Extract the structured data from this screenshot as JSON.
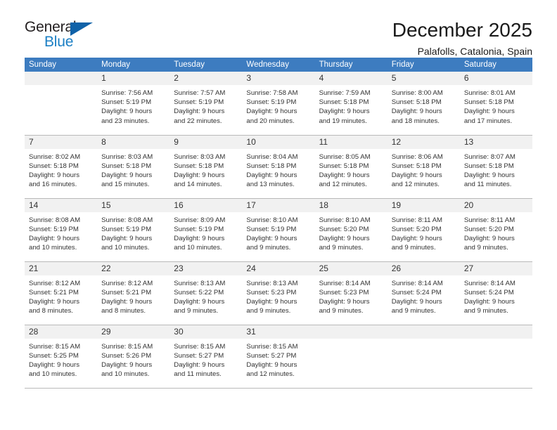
{
  "brand": {
    "name_top": "General",
    "name_bottom": "Blue",
    "triangle_color": "#1062a8",
    "blue_color": "#1b7fc4"
  },
  "header": {
    "title": "December 2025",
    "subtitle": "Palafolls, Catalonia, Spain"
  },
  "theme": {
    "header_bg": "#3d7cc0",
    "header_text": "#ffffff",
    "daynum_bg": "#f1f1f1",
    "border": "#b9b9b9",
    "body_text": "#333333"
  },
  "weekdays": [
    "Sunday",
    "Monday",
    "Tuesday",
    "Wednesday",
    "Thursday",
    "Friday",
    "Saturday"
  ],
  "labels": {
    "sunrise_prefix": "Sunrise:",
    "sunset_prefix": "Sunset:",
    "daylight_prefix": "Daylight:"
  },
  "weeks": [
    [
      {
        "day": "",
        "line1": "",
        "line2": "",
        "line3": "",
        "line4": ""
      },
      {
        "day": "1",
        "line1": "Sunrise: 7:56 AM",
        "line2": "Sunset: 5:19 PM",
        "line3": "Daylight: 9 hours",
        "line4": "and 23 minutes."
      },
      {
        "day": "2",
        "line1": "Sunrise: 7:57 AM",
        "line2": "Sunset: 5:19 PM",
        "line3": "Daylight: 9 hours",
        "line4": "and 22 minutes."
      },
      {
        "day": "3",
        "line1": "Sunrise: 7:58 AM",
        "line2": "Sunset: 5:19 PM",
        "line3": "Daylight: 9 hours",
        "line4": "and 20 minutes."
      },
      {
        "day": "4",
        "line1": "Sunrise: 7:59 AM",
        "line2": "Sunset: 5:18 PM",
        "line3": "Daylight: 9 hours",
        "line4": "and 19 minutes."
      },
      {
        "day": "5",
        "line1": "Sunrise: 8:00 AM",
        "line2": "Sunset: 5:18 PM",
        "line3": "Daylight: 9 hours",
        "line4": "and 18 minutes."
      },
      {
        "day": "6",
        "line1": "Sunrise: 8:01 AM",
        "line2": "Sunset: 5:18 PM",
        "line3": "Daylight: 9 hours",
        "line4": "and 17 minutes."
      }
    ],
    [
      {
        "day": "7",
        "line1": "Sunrise: 8:02 AM",
        "line2": "Sunset: 5:18 PM",
        "line3": "Daylight: 9 hours",
        "line4": "and 16 minutes."
      },
      {
        "day": "8",
        "line1": "Sunrise: 8:03 AM",
        "line2": "Sunset: 5:18 PM",
        "line3": "Daylight: 9 hours",
        "line4": "and 15 minutes."
      },
      {
        "day": "9",
        "line1": "Sunrise: 8:03 AM",
        "line2": "Sunset: 5:18 PM",
        "line3": "Daylight: 9 hours",
        "line4": "and 14 minutes."
      },
      {
        "day": "10",
        "line1": "Sunrise: 8:04 AM",
        "line2": "Sunset: 5:18 PM",
        "line3": "Daylight: 9 hours",
        "line4": "and 13 minutes."
      },
      {
        "day": "11",
        "line1": "Sunrise: 8:05 AM",
        "line2": "Sunset: 5:18 PM",
        "line3": "Daylight: 9 hours",
        "line4": "and 12 minutes."
      },
      {
        "day": "12",
        "line1": "Sunrise: 8:06 AM",
        "line2": "Sunset: 5:18 PM",
        "line3": "Daylight: 9 hours",
        "line4": "and 12 minutes."
      },
      {
        "day": "13",
        "line1": "Sunrise: 8:07 AM",
        "line2": "Sunset: 5:18 PM",
        "line3": "Daylight: 9 hours",
        "line4": "and 11 minutes."
      }
    ],
    [
      {
        "day": "14",
        "line1": "Sunrise: 8:08 AM",
        "line2": "Sunset: 5:19 PM",
        "line3": "Daylight: 9 hours",
        "line4": "and 10 minutes."
      },
      {
        "day": "15",
        "line1": "Sunrise: 8:08 AM",
        "line2": "Sunset: 5:19 PM",
        "line3": "Daylight: 9 hours",
        "line4": "and 10 minutes."
      },
      {
        "day": "16",
        "line1": "Sunrise: 8:09 AM",
        "line2": "Sunset: 5:19 PM",
        "line3": "Daylight: 9 hours",
        "line4": "and 10 minutes."
      },
      {
        "day": "17",
        "line1": "Sunrise: 8:10 AM",
        "line2": "Sunset: 5:19 PM",
        "line3": "Daylight: 9 hours",
        "line4": "and 9 minutes."
      },
      {
        "day": "18",
        "line1": "Sunrise: 8:10 AM",
        "line2": "Sunset: 5:20 PM",
        "line3": "Daylight: 9 hours",
        "line4": "and 9 minutes."
      },
      {
        "day": "19",
        "line1": "Sunrise: 8:11 AM",
        "line2": "Sunset: 5:20 PM",
        "line3": "Daylight: 9 hours",
        "line4": "and 9 minutes."
      },
      {
        "day": "20",
        "line1": "Sunrise: 8:11 AM",
        "line2": "Sunset: 5:20 PM",
        "line3": "Daylight: 9 hours",
        "line4": "and 9 minutes."
      }
    ],
    [
      {
        "day": "21",
        "line1": "Sunrise: 8:12 AM",
        "line2": "Sunset: 5:21 PM",
        "line3": "Daylight: 9 hours",
        "line4": "and 8 minutes."
      },
      {
        "day": "22",
        "line1": "Sunrise: 8:12 AM",
        "line2": "Sunset: 5:21 PM",
        "line3": "Daylight: 9 hours",
        "line4": "and 8 minutes."
      },
      {
        "day": "23",
        "line1": "Sunrise: 8:13 AM",
        "line2": "Sunset: 5:22 PM",
        "line3": "Daylight: 9 hours",
        "line4": "and 9 minutes."
      },
      {
        "day": "24",
        "line1": "Sunrise: 8:13 AM",
        "line2": "Sunset: 5:23 PM",
        "line3": "Daylight: 9 hours",
        "line4": "and 9 minutes."
      },
      {
        "day": "25",
        "line1": "Sunrise: 8:14 AM",
        "line2": "Sunset: 5:23 PM",
        "line3": "Daylight: 9 hours",
        "line4": "and 9 minutes."
      },
      {
        "day": "26",
        "line1": "Sunrise: 8:14 AM",
        "line2": "Sunset: 5:24 PM",
        "line3": "Daylight: 9 hours",
        "line4": "and 9 minutes."
      },
      {
        "day": "27",
        "line1": "Sunrise: 8:14 AM",
        "line2": "Sunset: 5:24 PM",
        "line3": "Daylight: 9 hours",
        "line4": "and 9 minutes."
      }
    ],
    [
      {
        "day": "28",
        "line1": "Sunrise: 8:15 AM",
        "line2": "Sunset: 5:25 PM",
        "line3": "Daylight: 9 hours",
        "line4": "and 10 minutes."
      },
      {
        "day": "29",
        "line1": "Sunrise: 8:15 AM",
        "line2": "Sunset: 5:26 PM",
        "line3": "Daylight: 9 hours",
        "line4": "and 10 minutes."
      },
      {
        "day": "30",
        "line1": "Sunrise: 8:15 AM",
        "line2": "Sunset: 5:27 PM",
        "line3": "Daylight: 9 hours",
        "line4": "and 11 minutes."
      },
      {
        "day": "31",
        "line1": "Sunrise: 8:15 AM",
        "line2": "Sunset: 5:27 PM",
        "line3": "Daylight: 9 hours",
        "line4": "and 12 minutes."
      },
      {
        "day": "",
        "line1": "",
        "line2": "",
        "line3": "",
        "line4": ""
      },
      {
        "day": "",
        "line1": "",
        "line2": "",
        "line3": "",
        "line4": ""
      },
      {
        "day": "",
        "line1": "",
        "line2": "",
        "line3": "",
        "line4": ""
      }
    ]
  ]
}
